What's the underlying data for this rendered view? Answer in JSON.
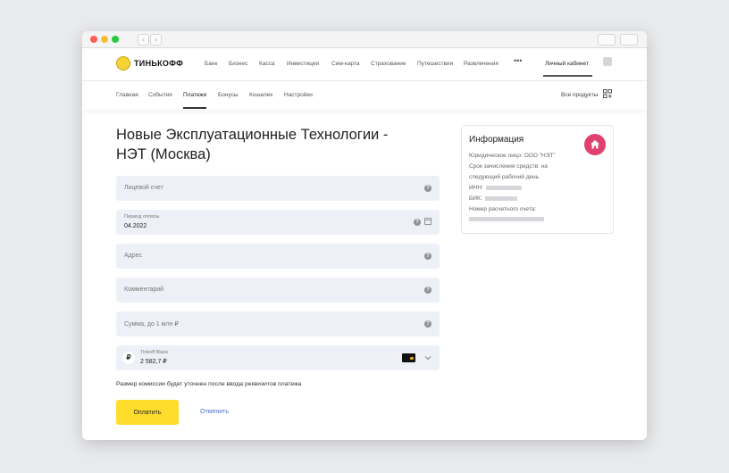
{
  "topnav": {
    "logo_text": "ТИНЬКОФФ",
    "items": [
      "Банк",
      "Бизнес",
      "Касса",
      "Инвестиции",
      "Сим-карта",
      "Страхование",
      "Путешествия",
      "Развлечения"
    ],
    "more": "•••",
    "account_label": "Личный кабинет"
  },
  "subnav": {
    "items": [
      "Главная",
      "События",
      "Платежи",
      "Бонусы",
      "Кошелек",
      "Настройки"
    ],
    "active": "Платежи",
    "all_products": "Все продукты"
  },
  "page": {
    "title": "Новые Эксплуатационные Технологии - НЭТ (Москва)"
  },
  "form": {
    "account_placeholder": "Лицевой счет",
    "period_label": "Период оплаты",
    "period_value": "04.2022",
    "address_placeholder": "Адрес",
    "comment_placeholder": "Комментарий",
    "amount_placeholder": "Сумма, до 1 млн ₽",
    "card_currency": "₽",
    "card_name": "Tinkoff Black",
    "card_balance": "2 582,7 ₽",
    "commission_note": "Размер комиссии будет уточнен после ввода реквизитов платежа",
    "pay_label": "Оплатить",
    "cancel_label": "Отменить",
    "help_glyph": "?"
  },
  "info": {
    "title": "Информация",
    "legal": "Юридическое лицо: ООО \"НЭТ\"",
    "term_1": "Срок зачисления средств: на",
    "term_2": "следующий рабочий день",
    "inn": "ИНН:",
    "bik": "БИК:",
    "account": "Номер расчетного счета:"
  },
  "colors": {
    "accent_yellow": "#ffdd2d",
    "field_bg": "#edf1f7",
    "home_badge": "#e0416f",
    "link_blue": "#4a74c9"
  }
}
